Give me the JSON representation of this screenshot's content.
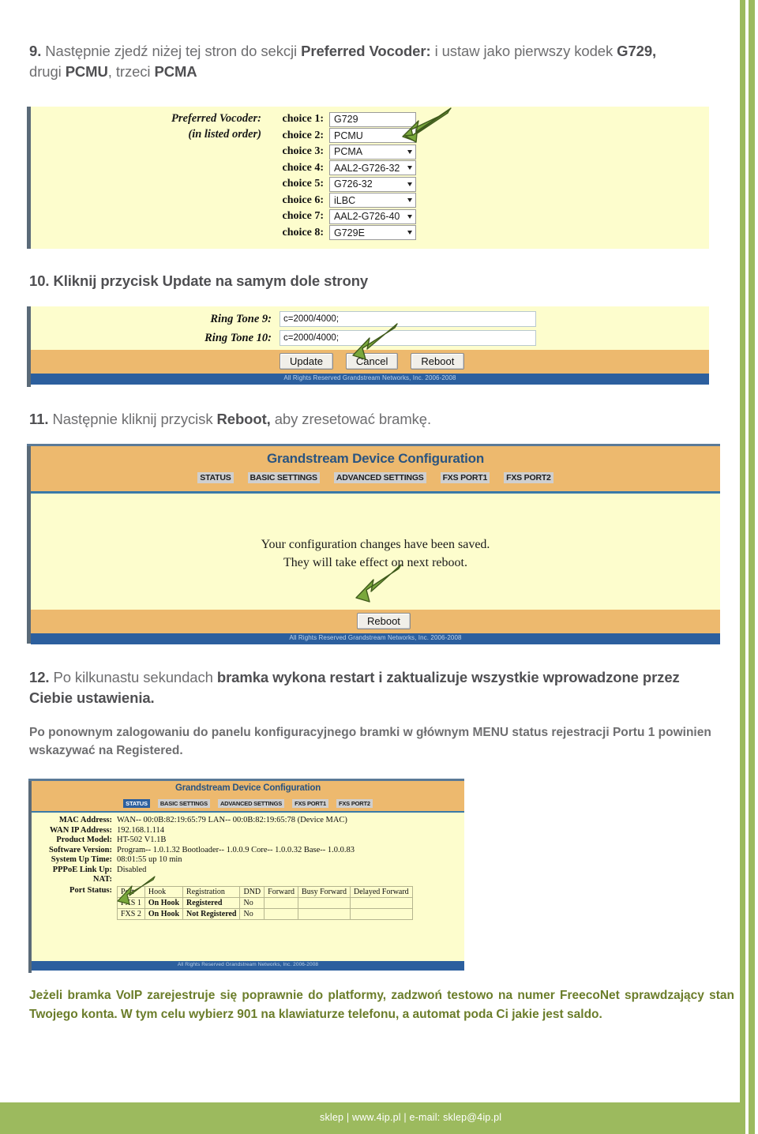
{
  "colors": {
    "accent_green": "#9cba5e",
    "arrow_green": "#7aa83c",
    "panel_yellow": "#fdfdcd",
    "panel_orange": "#edb96e",
    "nav_blue": "#2c5f9e",
    "text_grey": "#6e6e70",
    "text_olive": "#6b7d2a"
  },
  "steps": {
    "step9": {
      "number": "9.",
      "line1_a": "Następnie zjedź niżej tej stron do sekcji ",
      "line1_b": "Preferred Vocoder:",
      "line1_c": " i ustaw jako pierwszy kodek ",
      "line1_d": "G729,",
      "line2_a": "drugi ",
      "line2_b": "PCMU",
      "line2_c": ", trzeci ",
      "line2_d": "PCMA"
    },
    "step10": {
      "number": "10.",
      "text": "Kliknij przycisk Update na samym dole strony"
    },
    "step11": {
      "number": "11.",
      "text_a": "Następnie kliknij przycisk ",
      "text_b": "Reboot,",
      "text_c": " aby zresetować bramkę."
    },
    "step12": {
      "number": "12.",
      "text_a": "Po kilkunastu sekundach ",
      "text_b": "bramka wykona restart i zaktualizuje wszystkie wprowadzone przez Ciebie ustawienia."
    }
  },
  "paragraphs": {
    "after_step12": "Po ponownym zalogowaniu do panelu konfiguracyjnego bramki w głównym MENU status rejestracji Portu 1 powinien wskazywać na Registered.",
    "final": "Jeżeli bramka VoIP zarejestruje się poprawnie do platformy, zadzwoń testowo na numer FreecoNet sprawdzający stan Twojego konta.  W tym celu wybierz 901 na klawiaturze telefonu, a automat poda Ci jakie jest saldo."
  },
  "vocoder_panel": {
    "label_line1": "Preferred Vocoder:",
    "label_line2": "(in listed order)",
    "rows": [
      {
        "choice": "choice 1:",
        "value": "G729"
      },
      {
        "choice": "choice 2:",
        "value": "PCMU"
      },
      {
        "choice": "choice 3:",
        "value": "PCMA"
      },
      {
        "choice": "choice 4:",
        "value": "AAL2-G726-32"
      },
      {
        "choice": "choice 5:",
        "value": "G726-32"
      },
      {
        "choice": "choice 6:",
        "value": "iLBC"
      },
      {
        "choice": "choice 7:",
        "value": "AAL2-G726-40"
      },
      {
        "choice": "choice 8:",
        "value": "G729E"
      }
    ]
  },
  "ringtone_panel": {
    "rows": [
      {
        "label": "Ring Tone 9:",
        "value": "c=2000/4000;"
      },
      {
        "label": "Ring Tone 10:",
        "value": "c=2000/4000;"
      }
    ],
    "buttons": [
      "Update",
      "Cancel",
      "Reboot"
    ],
    "footer": "All Rights Reserved Grandstream Networks, Inc. 2006-2008"
  },
  "reboot_panel": {
    "title": "Grandstream Device Configuration",
    "nav": [
      "STATUS",
      "BASIC SETTINGS",
      "ADVANCED SETTINGS",
      "FXS PORT1",
      "FXS PORT2"
    ],
    "message_line1": "Your configuration changes have been saved.",
    "message_line2": "They will take effect on next reboot.",
    "button": "Reboot",
    "footer": "All Rights Reserved Grandstream Networks, Inc. 2006-2008"
  },
  "status_panel": {
    "title": "Grandstream Device Configuration",
    "nav": [
      "STATUS",
      "BASIC SETTINGS",
      "ADVANCED SETTINGS",
      "FXS PORT1",
      "FXS PORT2"
    ],
    "active_nav": "STATUS",
    "rows": [
      {
        "key": "MAC Address:",
        "value": "WAN-- 00:0B:82:19:65:79     LAN-- 00:0B:82:19:65:78 (Device MAC)"
      },
      {
        "key": "WAN IP Address:",
        "value": "192.168.1.114"
      },
      {
        "key": "Product Model:",
        "value": "HT-502 V1.1B"
      },
      {
        "key": "Software Version:",
        "value": "Program-- 1.0.1.32    Bootloader-- 1.0.0.9    Core-- 1.0.0.32    Base-- 1.0.0.83"
      },
      {
        "key": "System Up Time:",
        "value": "08:01:55 up 10 min"
      },
      {
        "key": "PPPoE Link Up:",
        "value": "Disabled"
      },
      {
        "key": "NAT:",
        "value": ""
      },
      {
        "key": "Port Status:",
        "value": ""
      }
    ],
    "port_table": {
      "headers": [
        "Port",
        "Hook",
        "Registration",
        "DND",
        "Forward",
        "Busy Forward",
        "Delayed Forward"
      ],
      "rows": [
        [
          "FXS 1",
          "On Hook",
          "Registered",
          "No",
          "",
          "",
          ""
        ],
        [
          "FXS 2",
          "On Hook",
          "Not Registered",
          "No",
          "",
          "",
          ""
        ]
      ]
    },
    "footer": "All Rights Reserved Grandstream Networks, Inc. 2006-2008"
  },
  "footer": {
    "text": "sklep | www.4ip.pl | e-mail: sklep@4ip.pl"
  }
}
